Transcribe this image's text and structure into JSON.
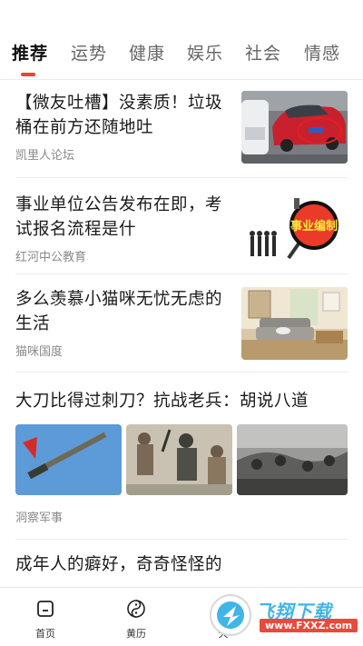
{
  "tabs": [
    {
      "label": "推荐",
      "active": true
    },
    {
      "label": "运势",
      "active": false
    },
    {
      "label": "健康",
      "active": false
    },
    {
      "label": "娱乐",
      "active": false
    },
    {
      "label": "社会",
      "active": false
    },
    {
      "label": "情感",
      "active": false
    }
  ],
  "feed": [
    {
      "title": "【微友吐槽】没素质！垃圾桶在前方还随地吐",
      "source": "凯里人论坛",
      "thumb": "red-car-photo"
    },
    {
      "title": "事业单位公告发布在即，考试报名流程是什",
      "source": "红河中公教育",
      "thumb": "job-exam-badge",
      "thumb_text": "事业编制"
    },
    {
      "title": "多么羡慕小猫咪无忧无虑的生活",
      "source": "猫咪国度",
      "thumb": "living-room-photo"
    },
    {
      "title": "大刀比得过刺刀？抗战老兵：胡说八道",
      "source": "洞察军事",
      "images": [
        "sword-photo",
        "soldiers-fighting-photo",
        "war-scene-photo"
      ]
    },
    {
      "title": "成年人的癖好，奇奇怪怪的",
      "source": ""
    }
  ],
  "bottom_nav": [
    {
      "label": "首页",
      "icon": "home-icon"
    },
    {
      "label": "黄历",
      "icon": "yinyang-icon"
    },
    {
      "label": "天",
      "icon": "weather-icon"
    }
  ],
  "watermark": {
    "text": "飞翔下载",
    "url": "www.FXXZ.com"
  },
  "colors": {
    "accent": "#e8443b",
    "text": "#1a1a1a",
    "muted": "#8a8a8a"
  }
}
